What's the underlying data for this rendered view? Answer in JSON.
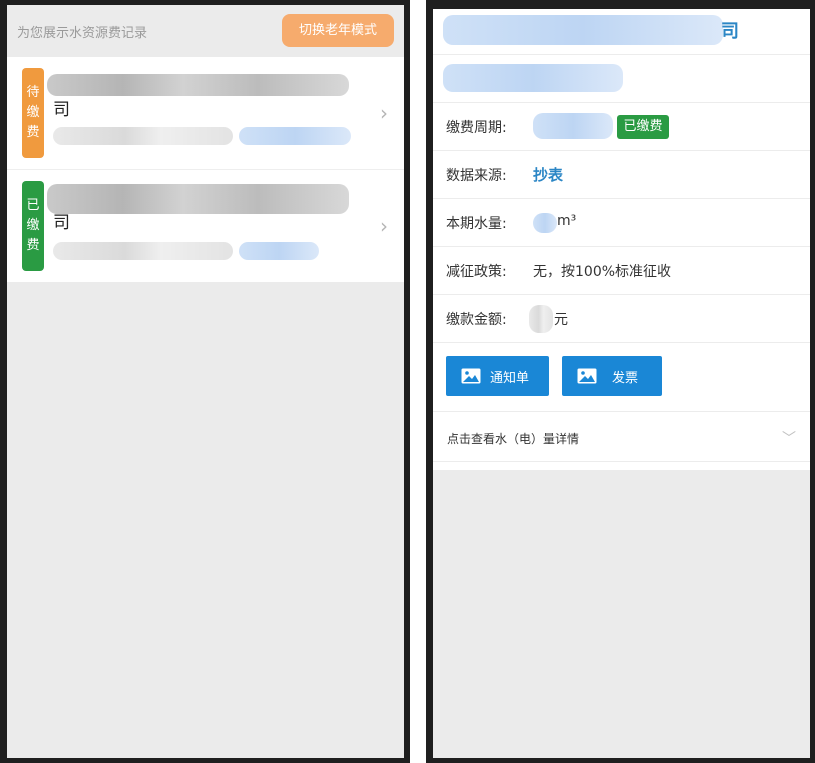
{
  "left": {
    "header_text": "为您展示水资源费记录",
    "mode_button": "切换老年模式",
    "records": [
      {
        "status_chars": [
          "待",
          "缴",
          "费"
        ],
        "company_tail": "司",
        "status_color": "#f09a3e"
      },
      {
        "status_chars": [
          "已",
          "缴",
          "费"
        ],
        "company_tail": "司",
        "status_color": "#2a9b43"
      }
    ],
    "chevron": "›"
  },
  "right": {
    "company_tail": "司",
    "period_label": "缴费周期:",
    "paid_badge": "已缴费",
    "source_label": "数据来源:",
    "source_value": "抄表",
    "volume_label": "本期水量:",
    "volume_unit": "m³",
    "policy_label": "减征政策:",
    "policy_value": "无，按100%标准征收",
    "amount_label": "缴款金额:",
    "amount_unit": "元",
    "notice_button": "通知单",
    "invoice_button": "发票",
    "details_link": "点击查看水（电）量详情",
    "chevron_down": "﹀"
  }
}
